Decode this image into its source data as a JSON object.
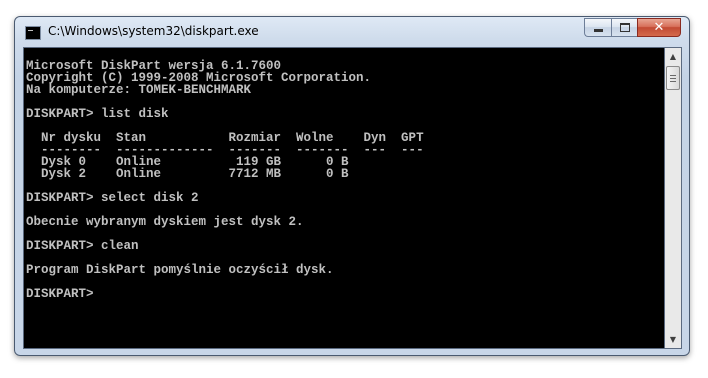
{
  "window": {
    "title": "C:\\Windows\\system32\\diskpart.exe",
    "close_glyph": "✕"
  },
  "console": {
    "lines": [
      "Microsoft DiskPart wersja 6.1.7600",
      "Copyright (C) 1999-2008 Microsoft Corporation.",
      "Na komputerze: TOMEK-BENCHMARK",
      "",
      "DISKPART> list disk",
      "",
      "  Nr dysku  Stan           Rozmiar  Wolne    Dyn  GPT",
      "  --------  -------------  -------  -------  ---  ---",
      "  Dysk 0    Online          119 GB      0 B",
      "  Dysk 2    Online         7712 MB      0 B",
      "",
      "DISKPART> select disk 2",
      "",
      "Obecnie wybranym dyskiem jest dysk 2.",
      "",
      "DISKPART> clean",
      "",
      "Program DiskPart pomyślnie oczyścił dysk.",
      "",
      "DISKPART>"
    ]
  },
  "scrollbar": {
    "up_glyph": "▲",
    "down_glyph": "▼"
  }
}
